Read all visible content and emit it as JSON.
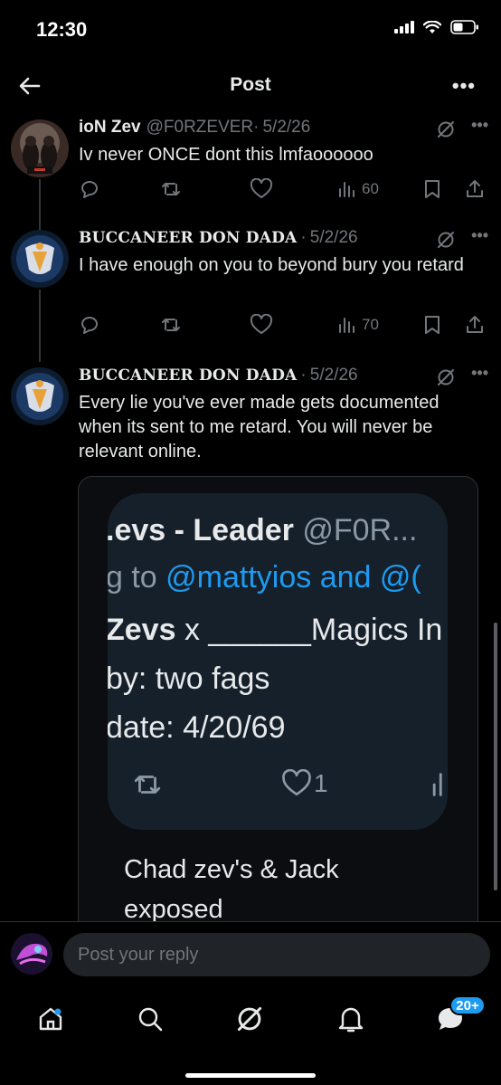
{
  "status_bar": {
    "time": "12:30"
  },
  "header": {
    "title": "Post",
    "more": "•••"
  },
  "posts": [
    {
      "name": "ioN Zev",
      "handle": "@F0RZEVER",
      "sep": "·",
      "date": "5/2/26",
      "text": "Iv never ONCE dont this lmfaoooooo",
      "views": "60",
      "more": "•••"
    },
    {
      "name": "BUCCANEER DON DADA",
      "sep": "·",
      "date": "5/2/26",
      "text": "I have enough on you to beyond bury you retard",
      "views": "70",
      "more": "•••"
    },
    {
      "name": "BUCCANEER DON DADA",
      "sep": "·",
      "date": "5/2/26",
      "text": "Every lie you've ever made gets documented when its sent to me retard. You will never be relevant online.",
      "more": "•••"
    }
  ],
  "quote": {
    "line1_bold": ".evs - Leader",
    "line1_gray": " @F0R...",
    "line2_prefix": "g to ",
    "line2_mention": "@mattyios and @(",
    "line3_bold": "Zevs",
    "line3_rest": " x ______Magics In",
    "line4": "by: two fags",
    "line5": " date: 4/20/69",
    "like_count": "1",
    "caption": "Chad zev's & Jack exposed"
  },
  "reply": {
    "placeholder": "Post your reply"
  },
  "tabs": {
    "notifications_badge": "20+"
  },
  "icons": [
    "back-arrow-icon",
    "signal-icon",
    "wifi-icon",
    "battery-icon",
    "grok-icon",
    "reply-icon",
    "repost-icon",
    "like-icon",
    "views-icon",
    "bookmark-icon",
    "share-icon",
    "home-icon",
    "search-icon",
    "notifications-icon",
    "messages-icon"
  ],
  "colors": {
    "background": "#000000",
    "text": "#e7e9ea",
    "muted": "#71767b",
    "accent": "#1d9bf0",
    "divider": "#2f3336"
  }
}
